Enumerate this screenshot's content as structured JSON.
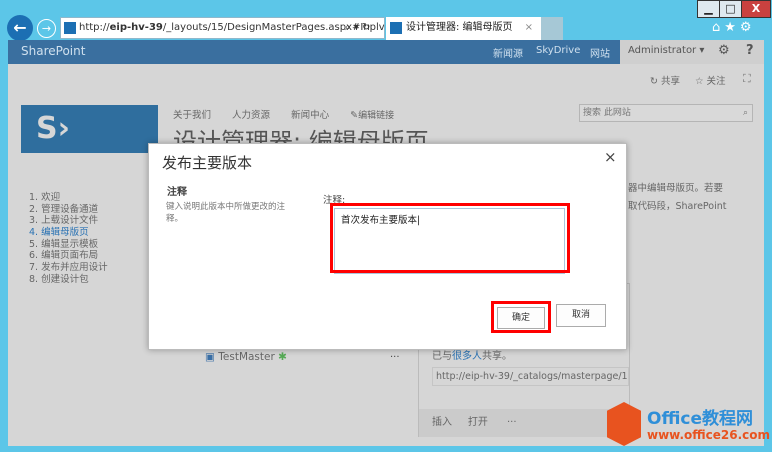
{
  "browser": {
    "url_prefix": "http://",
    "url_host": "eip-hv-39",
    "url_rest": "/_layouts/15/DesignMasterPages.aspx#Inplv",
    "tab_title": "设计管理器: 编辑母版页",
    "tab_close": "×",
    "min": "▁",
    "max": "□",
    "close": "X"
  },
  "suitebar": {
    "brand": "SharePoint",
    "links": [
      "新闻源",
      "SkyDrive",
      "网站"
    ],
    "user": "Administrator ▾",
    "gear": "⚙",
    "help": "?"
  },
  "ribbon": {
    "share": "共享",
    "follow": "关注"
  },
  "topnav": [
    "关于我们",
    "人力资源",
    "新闻中心",
    "编辑链接"
  ],
  "search_placeholder": "搜索 此网站",
  "page_title": "设计管理器: 编辑母版页",
  "steps": [
    "1. 欢迎",
    "2. 管理设备通道",
    "3. 上载设计文件",
    "4. 编辑母版页",
    "5. 编辑显示模板",
    "6. 编辑页面布局",
    "7. 发布并应用设计",
    "8. 创建设计包"
  ],
  "right_text": [
    "器中编辑母版页。若要",
    "取代码段，SharePoint"
  ],
  "file": {
    "name": "TestMaster",
    "more": "···"
  },
  "callout": {
    "shared_prefix": "已与",
    "shared_link": "很多人",
    "shared_suffix": "共享。",
    "url": "http://eip-hv-39/_catalogs/masterpage/1",
    "actions": [
      "插入",
      "打开",
      "···"
    ],
    "close": "×"
  },
  "dialog": {
    "title": "发布主要版本",
    "close": "×",
    "section": "注释",
    "desc": "键入说明此版本中所做更改的注释。",
    "field_label": "注释:",
    "field_value": "首次发布主要版本",
    "ok": "确定",
    "cancel": "取消"
  },
  "watermark": {
    "brand": "Office教程网",
    "url": "www.office26.com"
  }
}
